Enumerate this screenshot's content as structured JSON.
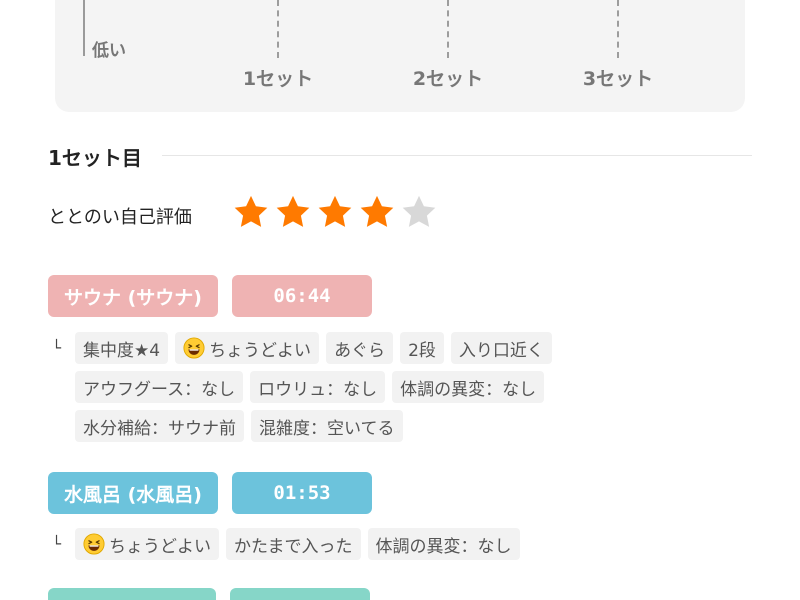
{
  "chart": {
    "y_low_label": "低い",
    "x_ticks": [
      "1セット",
      "2セット",
      "3セット"
    ]
  },
  "set": {
    "title": "1セット目",
    "rating_label": "ととのい自己評価",
    "rating": 4,
    "rating_max": 5
  },
  "colors": {
    "sauna": "#efb3b3",
    "water": "#6cc3dc",
    "rest": "#86d6c8",
    "star_on": "#ff7a00",
    "star_off": "#d8d8d8"
  },
  "sauna": {
    "name": "サウナ (サウナ)",
    "time": "06:44",
    "tags": [
      [
        "集中度★4",
        "ちょうどよい",
        "あぐら",
        "2段",
        "入り口近く"
      ],
      [
        "アウフグース：なし",
        "ロウリュ：なし",
        "体調の異変：なし"
      ],
      [
        "水分補給：サウナ前",
        "混雑度：空いてる"
      ]
    ]
  },
  "water": {
    "name": "水風呂 (水風呂)",
    "time": "01:53",
    "tags": [
      [
        "ちょうどよい",
        "かたまで入った",
        "体調の異変：なし"
      ]
    ]
  }
}
